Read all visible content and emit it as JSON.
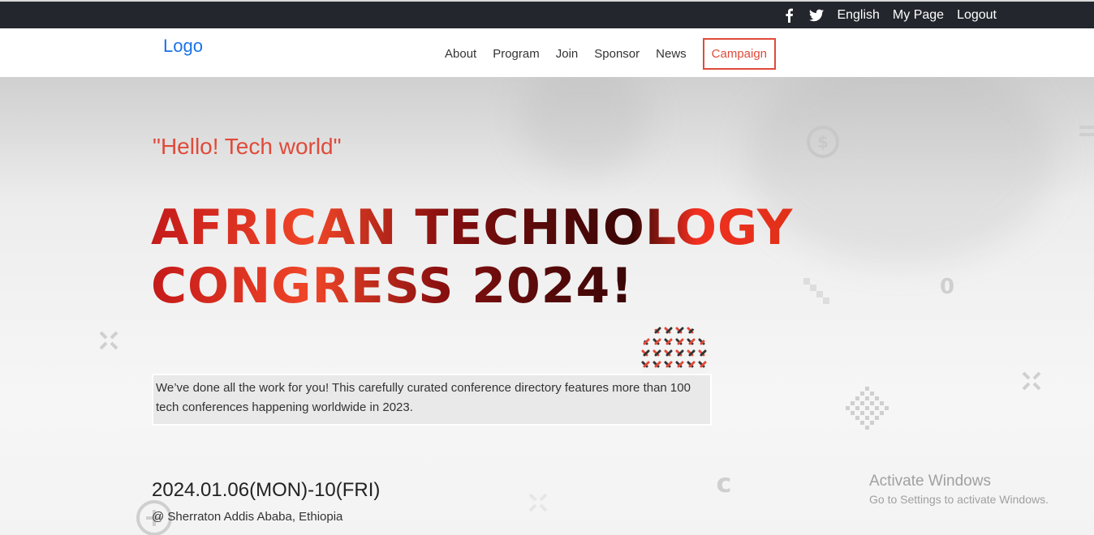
{
  "topbar": {
    "facebook_icon": "facebook-icon",
    "twitter_icon": "twitter-icon",
    "language": "English",
    "mypage": "My Page",
    "logout": "Logout"
  },
  "header": {
    "logo": "Logo",
    "nav": [
      "About",
      "Program",
      "Join",
      "Sponsor",
      "News",
      "Campaign"
    ]
  },
  "hero": {
    "greeting": "\"Hello! Tech world\"",
    "title_line1": "AFRICAN TECHNOLOGY",
    "title_line2": "CONGRESS 2024!",
    "description": "We’ve done all the work for you! This carefully curated conference directory features more than 100 tech conferences happening worldwide in 2023.",
    "date": "2024.01.06(MON)-10(FRI)",
    "venue": "@ Sherraton Addis Ababa, Ethiopia"
  },
  "watermark": {
    "line1": "Activate Windows",
    "line2": "Go to Settings to activate Windows."
  },
  "colors": {
    "accent": "#e04a3a",
    "topbar": "#23262d",
    "logo": "#1a73e8"
  }
}
